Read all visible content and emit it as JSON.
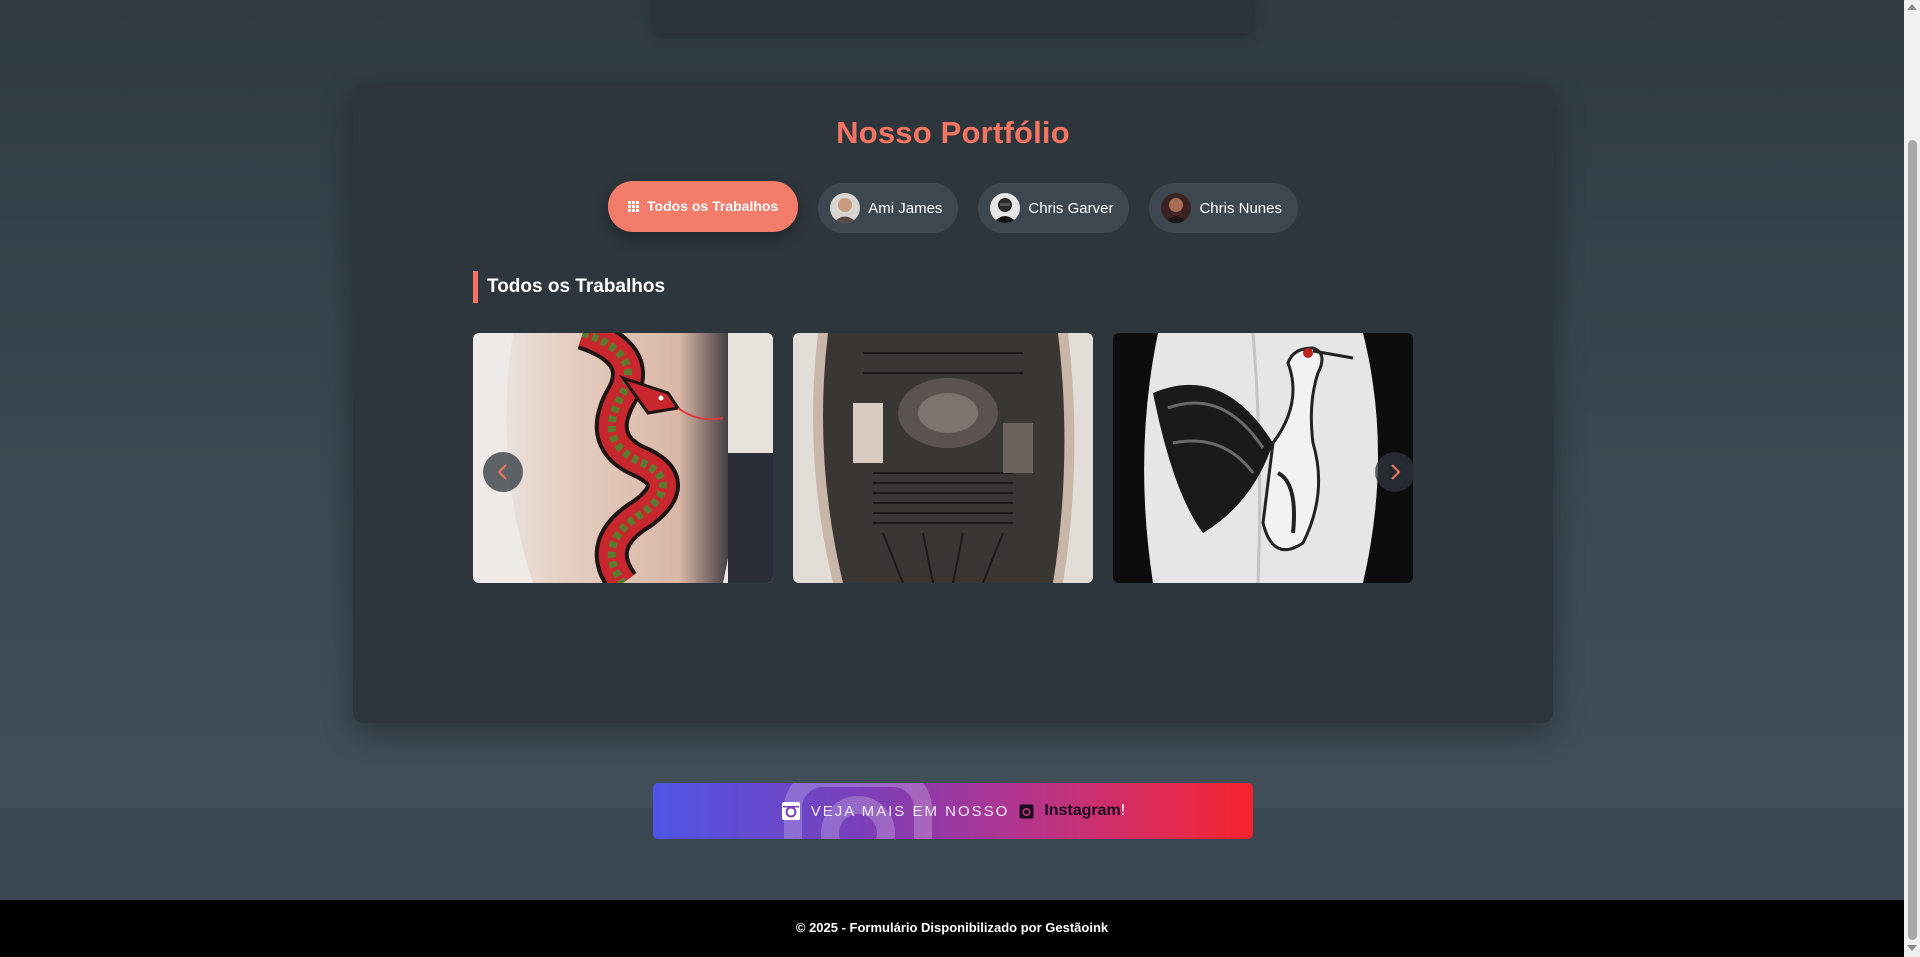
{
  "portfolio": {
    "title": "Nosso Portfólio",
    "filters": [
      {
        "label": "Todos os Trabalhos",
        "active": true,
        "icon": "grid-icon"
      },
      {
        "label": "Ami James",
        "active": false
      },
      {
        "label": "Chris Garver",
        "active": false
      },
      {
        "label": "Chris Nunes",
        "active": false
      }
    ],
    "section_heading": "Todos os Trabalhos",
    "gallery": [
      "snake-tattoo-photo",
      "samurai-tattoo-photo",
      "crane-back-tattoo-photo"
    ]
  },
  "instagram": {
    "prefix": "VEJA MAIS EM NOSSO",
    "name": "Instagram",
    "suffix": "!"
  },
  "footer": {
    "text": "© 2025 - Formulário Disponibilizado por Gestãoink"
  },
  "colors": {
    "accent": "#f27461",
    "active_filter": "#f47c6a",
    "card_bg": "#2d363d",
    "footer_bg": "#000000"
  }
}
